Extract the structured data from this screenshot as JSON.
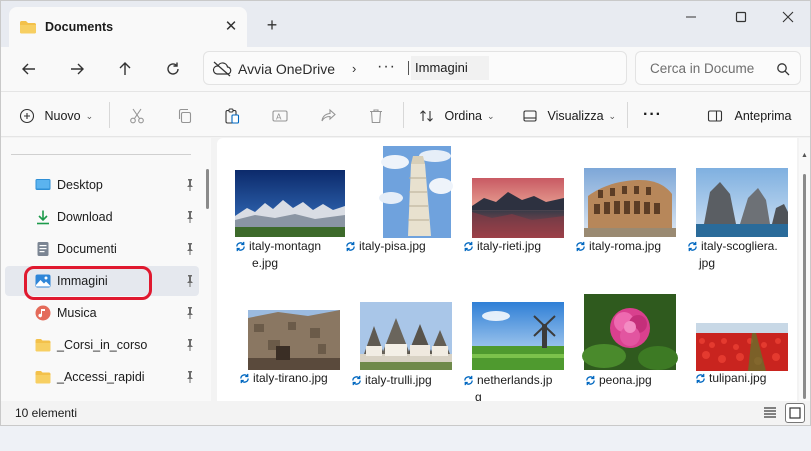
{
  "window": {
    "tab_title": "Documents",
    "tab_close": "✕",
    "new_tab": "+"
  },
  "address": {
    "onedrive_label": "Avvia OneDrive",
    "chevron": "›",
    "overflow": "···",
    "current_folder": "Immagini"
  },
  "search": {
    "placeholder": "Cerca in Docume"
  },
  "toolbar": {
    "new_label": "Nuovo",
    "sort_label": "Ordina",
    "view_label": "Visualizza",
    "more_label": "···",
    "preview_label": "Anteprima"
  },
  "sidebar": {
    "items": [
      {
        "label": "Desktop",
        "icon": "desktop-icon"
      },
      {
        "label": "Download",
        "icon": "download-icon"
      },
      {
        "label": "Documenti",
        "icon": "document-icon"
      },
      {
        "label": "Immagini",
        "icon": "pictures-icon",
        "selected": true
      },
      {
        "label": "Musica",
        "icon": "music-icon"
      },
      {
        "label": "_Corsi_in_corso",
        "icon": "folder-icon"
      },
      {
        "label": "_Accessi_rapidi",
        "icon": "folder-icon"
      }
    ]
  },
  "files": [
    {
      "name": "italy-montagne.jpg",
      "line1": "italy-montagn",
      "line2": "e.jpg"
    },
    {
      "name": "italy-pisa.jpg",
      "line1": "italy-pisa.jpg",
      "line2": ""
    },
    {
      "name": "italy-rieti.jpg",
      "line1": "italy-rieti.jpg",
      "line2": ""
    },
    {
      "name": "italy-roma.jpg",
      "line1": "italy-roma.jpg",
      "line2": ""
    },
    {
      "name": "italy-scogliera.jpg",
      "line1": "italy-scogliera.",
      "line2": "jpg"
    },
    {
      "name": "italy-tirano.jpg",
      "line1": "italy-tirano.jpg",
      "line2": ""
    },
    {
      "name": "italy-trulli.jpg",
      "line1": "italy-trulli.jpg",
      "line2": ""
    },
    {
      "name": "netherlands.jpg",
      "line1": "netherlands.jp",
      "line2": "g"
    },
    {
      "name": "peona.jpg",
      "line1": "peona.jpg",
      "line2": ""
    },
    {
      "name": "tulipani.jpg",
      "line1": "tulipani.jpg",
      "line2": ""
    }
  ],
  "status": {
    "count": "10 elementi"
  },
  "colors": {
    "accent": "#0067c0",
    "highlight_ring": "#e0192f",
    "folder": "#f3c14b"
  }
}
